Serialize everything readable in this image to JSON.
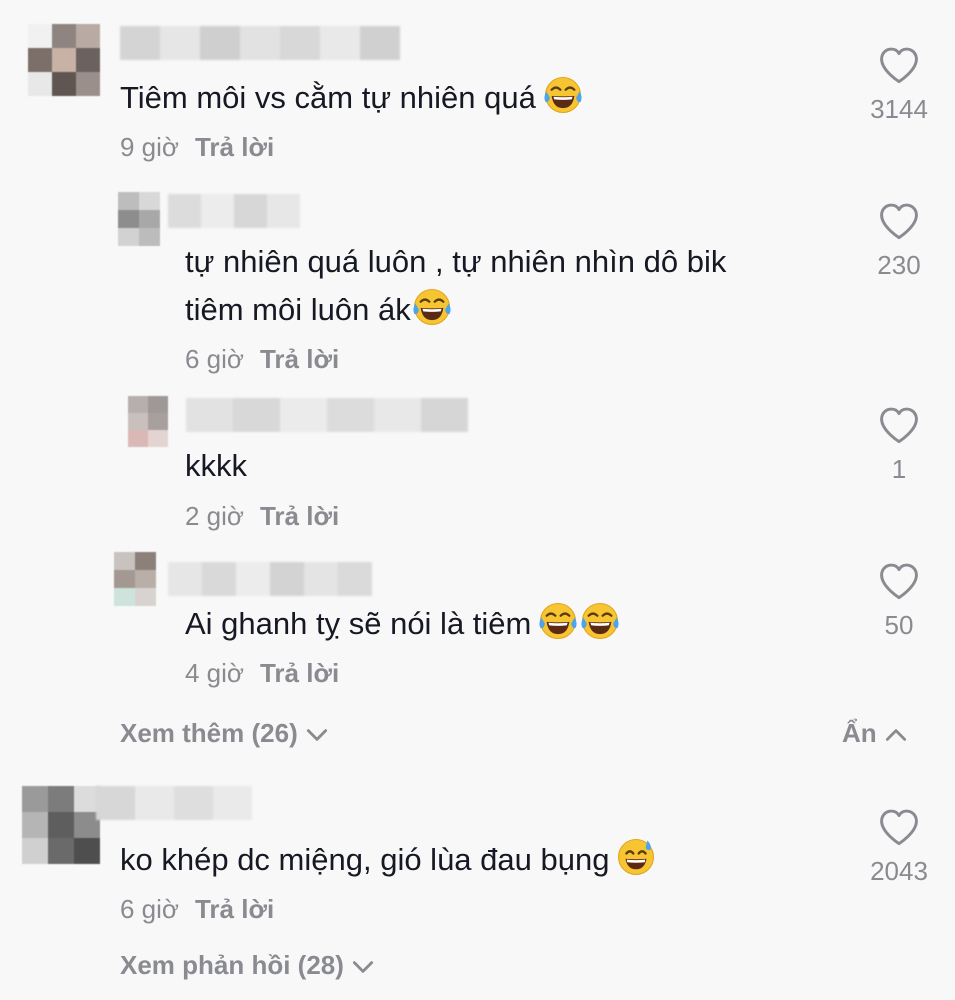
{
  "comments": [
    {
      "text_lines": [
        "Tiêm môi vs cằm tự nhiên quá"
      ],
      "emoji": [
        "face-with-tears-of-joy"
      ],
      "time": "9 giờ",
      "reply_label": "Trả lời",
      "likes": "3144"
    },
    {
      "text_lines": [
        "tự nhiên quá luôn , tự nhiên nhìn dô bik",
        "tiêm môi luôn ák"
      ],
      "emoji": [
        "face-with-tears-of-joy"
      ],
      "time": "6 giờ",
      "reply_label": "Trả lời",
      "likes": "230"
    },
    {
      "text_lines": [
        "kkkk"
      ],
      "emoji": [],
      "time": "2 giờ",
      "reply_label": "Trả lời",
      "likes": "1"
    },
    {
      "text_lines": [
        "Ai ghanh tỵ sẽ nói là tiêm"
      ],
      "emoji": [
        "face-with-tears-of-joy",
        "face-with-tears-of-joy"
      ],
      "time": "4 giờ",
      "reply_label": "Trả lời",
      "likes": "50"
    },
    {
      "text_lines": [
        "ko khép dc miệng, gió lùa đau bụng"
      ],
      "emoji": [
        "grinning-face-with-sweat"
      ],
      "time": "6 giờ",
      "reply_label": "Trả lời",
      "likes": "2043"
    }
  ],
  "view_more": "Xem thêm (26)",
  "hide": "Ẩn",
  "view_replies": "Xem phản hồi (28)",
  "colors": {
    "text": "#161823",
    "secondary": "#8a8b91",
    "background": "#f8f8f8",
    "heart_outline": "#8a8b91"
  },
  "icons": {
    "like": "heart-outline-icon",
    "expand": "chevron-down-icon",
    "collapse": "chevron-up-icon"
  }
}
